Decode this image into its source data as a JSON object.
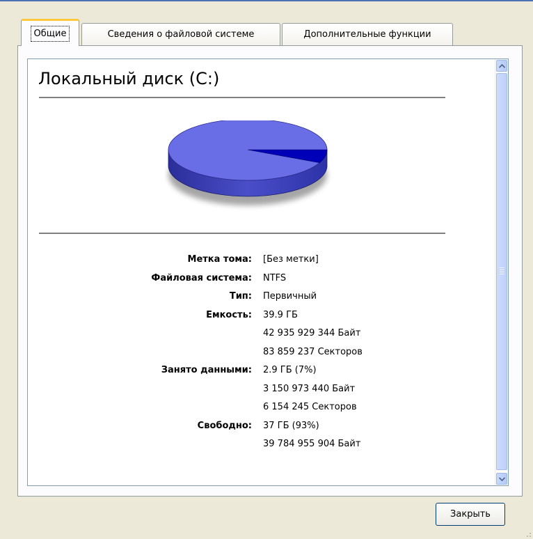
{
  "tabs": [
    {
      "label": "Общие",
      "active": true
    },
    {
      "label": "Сведения о файловой системе",
      "active": false
    },
    {
      "label": "Дополнительные функции",
      "active": false
    }
  ],
  "disk": {
    "title": "Локальный диск (C:)"
  },
  "chart_data": {
    "type": "pie",
    "slices": [
      {
        "label": "Свободно",
        "value": 93,
        "color": "#6a6ee6"
      },
      {
        "label": "Занято данными",
        "value": 7,
        "color": "#0000b8"
      }
    ]
  },
  "properties": [
    {
      "label": "Метка тома:",
      "value": "[Без метки]"
    },
    {
      "label": "Файловая система:",
      "value": "NTFS"
    },
    {
      "label": "Тип:",
      "value": "Первичный"
    },
    {
      "label": "Емкость:",
      "value": "39.9 ГБ"
    },
    {
      "label": "",
      "value": "42 935 929 344 Байт"
    },
    {
      "label": "",
      "value": "83 859 237 Секторов"
    },
    {
      "label": "Занято данными:",
      "value": "2.9 ГБ (7%)"
    },
    {
      "label": "",
      "value": "3 150 973 440 Байт"
    },
    {
      "label": "",
      "value": "6 154 245 Секторов"
    },
    {
      "label": "Свободно:",
      "value": "37 ГБ (93%)"
    },
    {
      "label": "",
      "value": "39 784 955 904 Байт"
    }
  ],
  "buttons": {
    "close": "Закрыть"
  }
}
